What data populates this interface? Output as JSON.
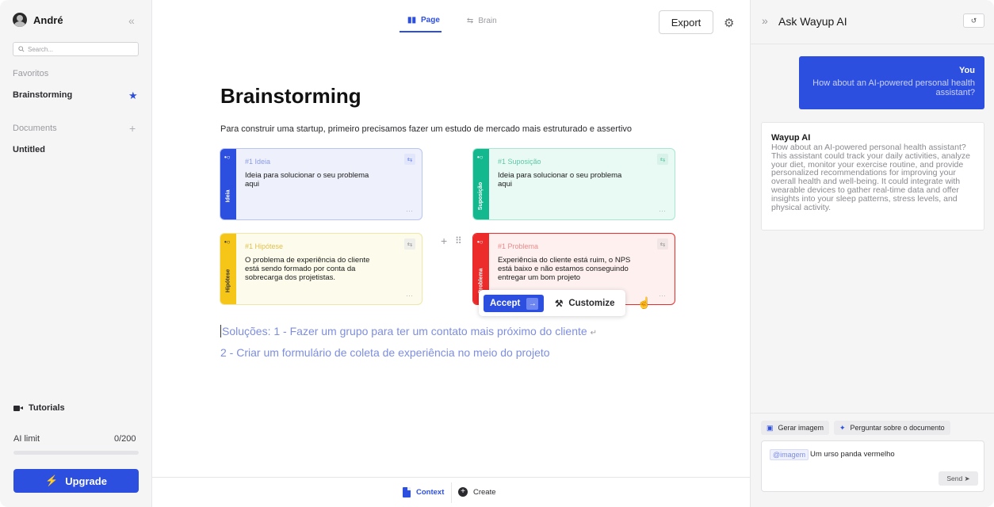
{
  "sidebar": {
    "user_name": "André",
    "search_placeholder": "Search...",
    "favorites_label": "Favoritos",
    "favorites": [
      {
        "label": "Brainstorming"
      }
    ],
    "documents_label": "Documents",
    "documents": [
      {
        "label": "Untitled"
      }
    ],
    "tutorials_label": "Tutorials",
    "ai_limit_label": "AI limit",
    "ai_limit_value": "0/200",
    "ai_limit_progress": 0,
    "upgrade_label": "Upgrade"
  },
  "header": {
    "tabs": [
      {
        "label": "Page",
        "active": true
      },
      {
        "label": "Brain",
        "active": false
      }
    ],
    "export_label": "Export"
  },
  "doc": {
    "title": "Brainstorming",
    "intro": "Para construir uma startup, primeiro precisamos fazer um estudo de mercado mais estruturado e assertivo",
    "cards": [
      {
        "strip": "Ideia",
        "tag": "#1 Ideia",
        "text": "Ideia para solucionar o seu problema aqui",
        "color": "#2d4fe0"
      },
      {
        "strip": "Suposição",
        "tag": "#1 Suposição",
        "text": "Ideia para solucionar o seu problema aqui",
        "color": "#14b88f"
      },
      {
        "strip": "Hipótese",
        "tag": "#1 Hipótese",
        "text": "O problema de experiência do cliente está sendo formado por conta da sobrecarga dos projetistas.",
        "color": "#f5c518"
      },
      {
        "strip": "Problema",
        "tag": "#1 Problema",
        "text": "Experiência do cliente está ruim, o NPS está baixo e não estamos conseguindo entregar um bom projeto",
        "color": "#ec2b2b"
      }
    ],
    "popup": {
      "accept_label": "Accept",
      "customize_label": "Customize"
    },
    "solutions": [
      "Soluções: 1 - Fazer um grupo para ter um contato mais próximo do cliente",
      "2 - Criar um formulário de coleta de experiência no meio do projeto"
    ]
  },
  "bottom_bar": {
    "context_label": "Context",
    "create_label": "Create"
  },
  "assistant": {
    "title": "Ask Wayup AI",
    "messages": [
      {
        "author": "You",
        "text": "How about an AI-powered personal health assistant?"
      },
      {
        "author": "Wayup AI",
        "text": "How about an AI-powered personal health assistant? This assistant could track your daily activities, analyze your diet, monitor your exercise routine, and provide personalized recommendations for improving your overall health and well-being. It could integrate with wearable devices to gather real-time data and offer insights into your sleep patterns, stress levels, and physical activity."
      }
    ],
    "chips": [
      {
        "label": "Gerar imagem"
      },
      {
        "label": "Perguntar sobre o documento"
      }
    ],
    "compose_mention": "@imagem",
    "compose_text": "Um urso panda vermelho",
    "send_label": "Send"
  },
  "colors": {
    "accent": "#2d4fe0",
    "idea": "#2d4fe0",
    "assumption": "#14b88f",
    "hypothesis": "#f5c518",
    "problem": "#ec2b2b"
  }
}
